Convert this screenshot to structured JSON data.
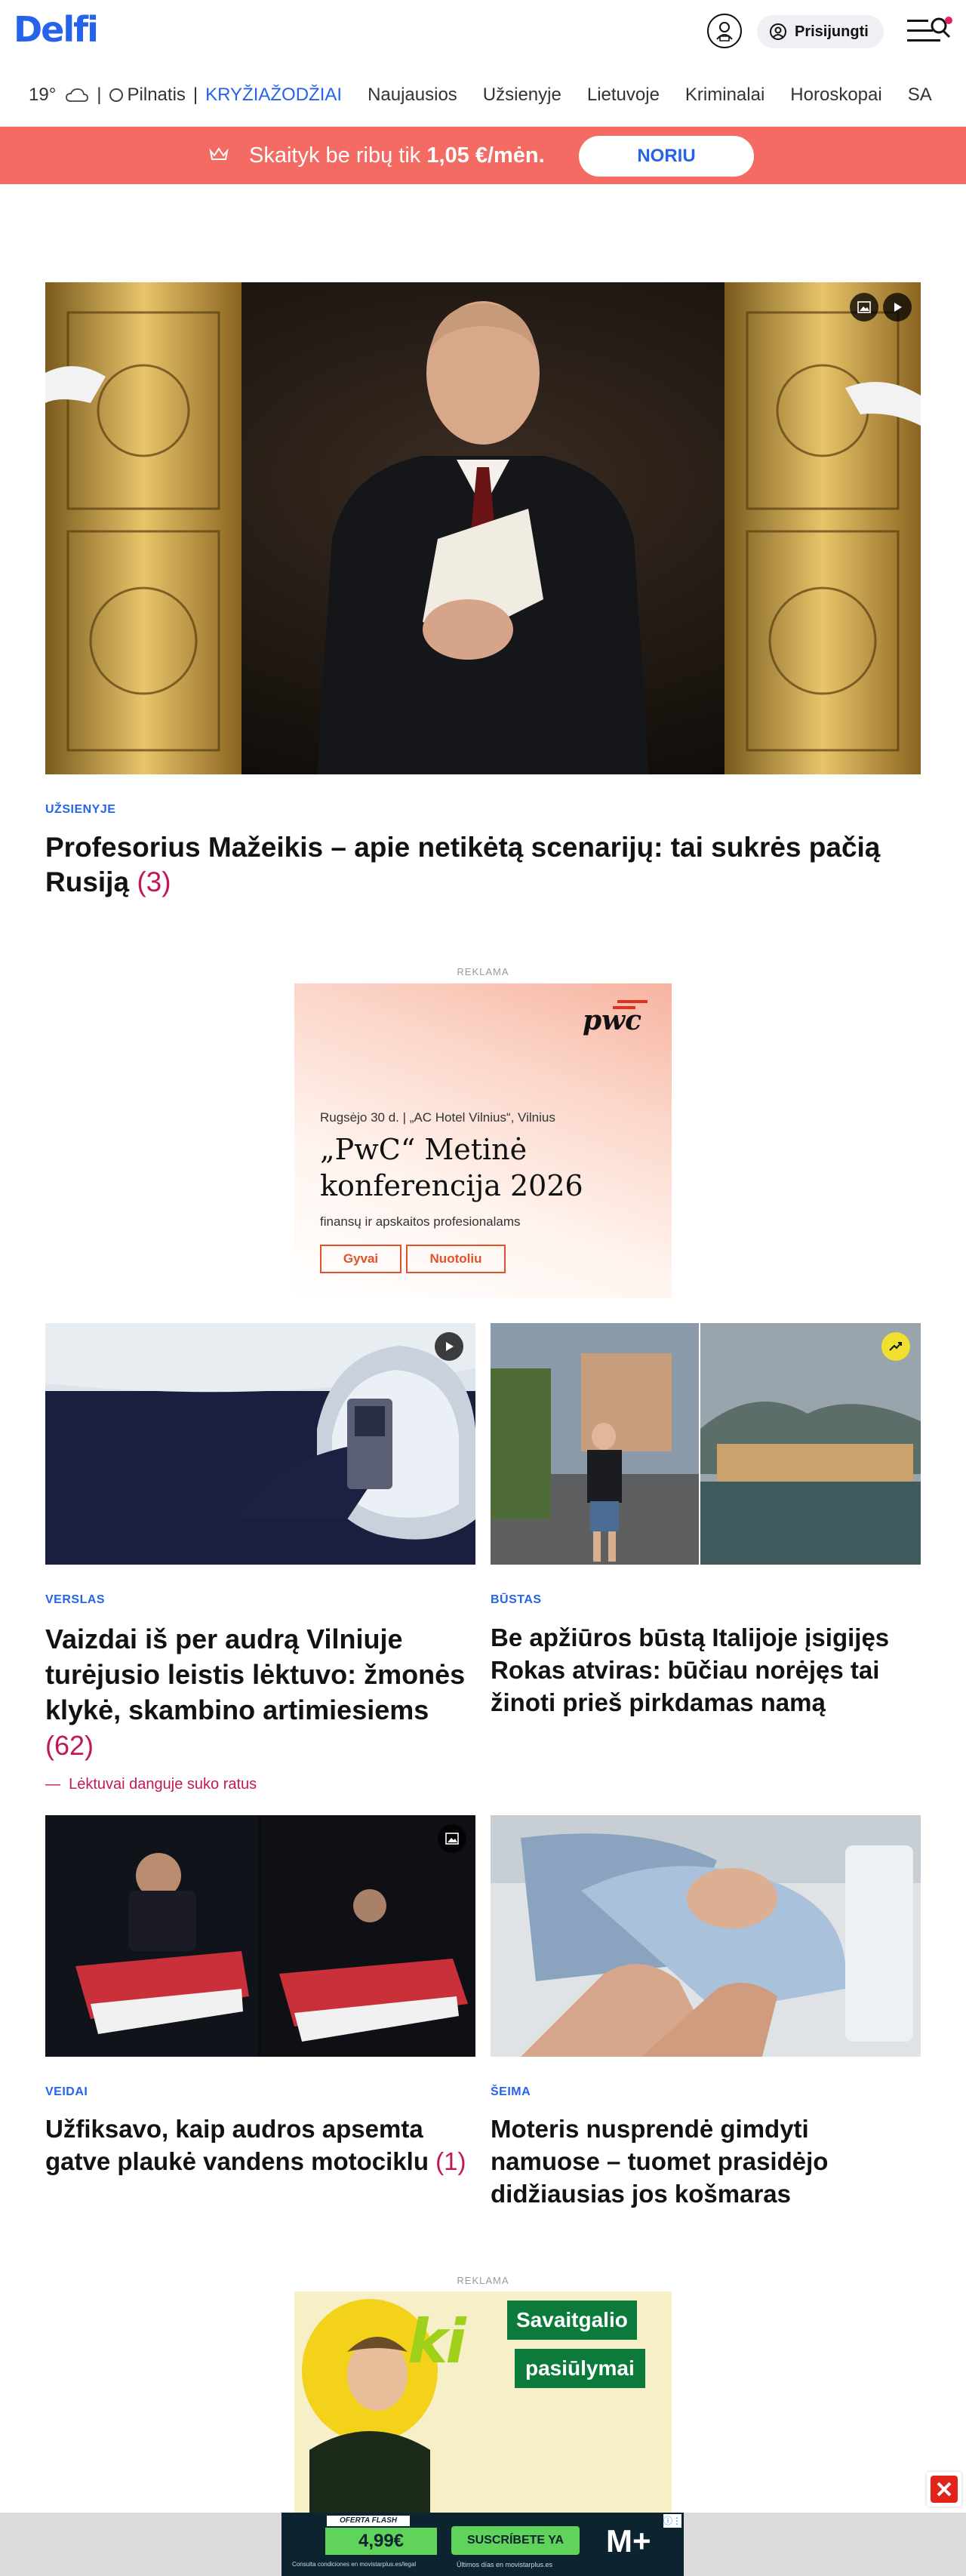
{
  "header": {
    "logo": "Delfi",
    "login_label": "Prisijungti"
  },
  "nav": {
    "temperature": "19°",
    "weather_icon": "cloud-icon",
    "pilnatis": "Pilnatis",
    "items": [
      {
        "label": "KRYŽIAŽODŽIAI"
      },
      {
        "label": "Naujausios"
      },
      {
        "label": "Užsienyje"
      },
      {
        "label": "Lietuvoje"
      },
      {
        "label": "Kriminalai"
      },
      {
        "label": "Horoskopai"
      },
      {
        "label": "SA"
      }
    ]
  },
  "promo": {
    "text_prefix": "Skaityk be ribų tik ",
    "price": "1,05 €/mėn.",
    "button": "NORIU"
  },
  "hero": {
    "category": "UŽSIENYJE",
    "title": "Profesorius Mažeikis – apie netikėtą scenarijų: tai sukrės pačią Rusiją",
    "comments": "(3)"
  },
  "ad1": {
    "label": "REKLAMA",
    "logo": "pwc",
    "date": "Rugsėjo 30 d. | „AC Hotel Vilnius“, Vilnius",
    "title_line1": "„PwC“ Metinė",
    "title_line2": "konferencija 2026",
    "subtitle": "finansų ir apskaitos profesionalams",
    "btn1": "Gyvai",
    "btn2": "Nuotoliu"
  },
  "articles": [
    {
      "category": "VERSLAS",
      "title": "Vaizdai iš per audrą Vilniuje turėjusio leistis lėktuvo: žmonės klykė, skambino artimiesiems",
      "comments": "(62)",
      "subline": "Lėktuvai danguje suko ratus"
    },
    {
      "category": "BŪSTAS",
      "title": "Be apžiūros būstą Italijoje įsigijęs Rokas atviras: būčiau norėjęs tai žinoti prieš pirkdamas namą"
    },
    {
      "category": "VEIDAI",
      "title": "Užfiksavo, kaip audros apsemta gatve plaukė vandens motociklu",
      "comments": "(1)"
    },
    {
      "category": "ŠEIMA",
      "title": "Moteris nusprendė gimdyti namuose – tuomet prasidėjo didžiausias jos košmaras"
    }
  ],
  "ad2": {
    "label": "REKLAMA",
    "brand": "ki",
    "line1": "Savaitgalio",
    "line2": "pasiūlymai"
  },
  "bottom_ad": {
    "oferta": "OFERTA FLASH",
    "price": "4,99€",
    "cta": "SUSCRÍBETE YA",
    "fine_left": "Consulta condiciones en movistarplus.es/legal",
    "fine_right": "Últimos días en movistarplus.es",
    "brand": "M+"
  }
}
